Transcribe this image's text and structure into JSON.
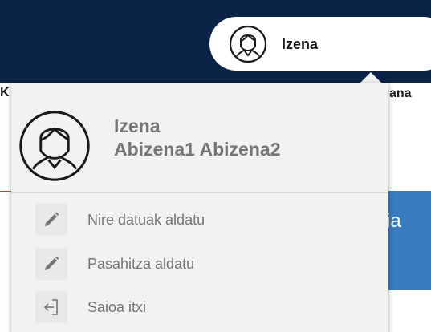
{
  "header": {
    "user_name": "Izena",
    "left_text": "K",
    "right_text": "ana"
  },
  "background": {
    "card_text": "ria"
  },
  "dropdown": {
    "first_name": "Izena",
    "surnames": "Abizena1 Abizena2",
    "items": [
      {
        "label": "Nire datuak aldatu",
        "icon": "pencil-icon"
      },
      {
        "label": "Pasahitza aldatu",
        "icon": "pencil-icon"
      },
      {
        "label": "Saioa itxi",
        "icon": "logout-icon"
      }
    ]
  },
  "colors": {
    "topbar": "#0b2347",
    "dropdown_bg": "#f2f2f2",
    "text_gray": "#757575",
    "accent_blue": "#3a7cc0"
  }
}
